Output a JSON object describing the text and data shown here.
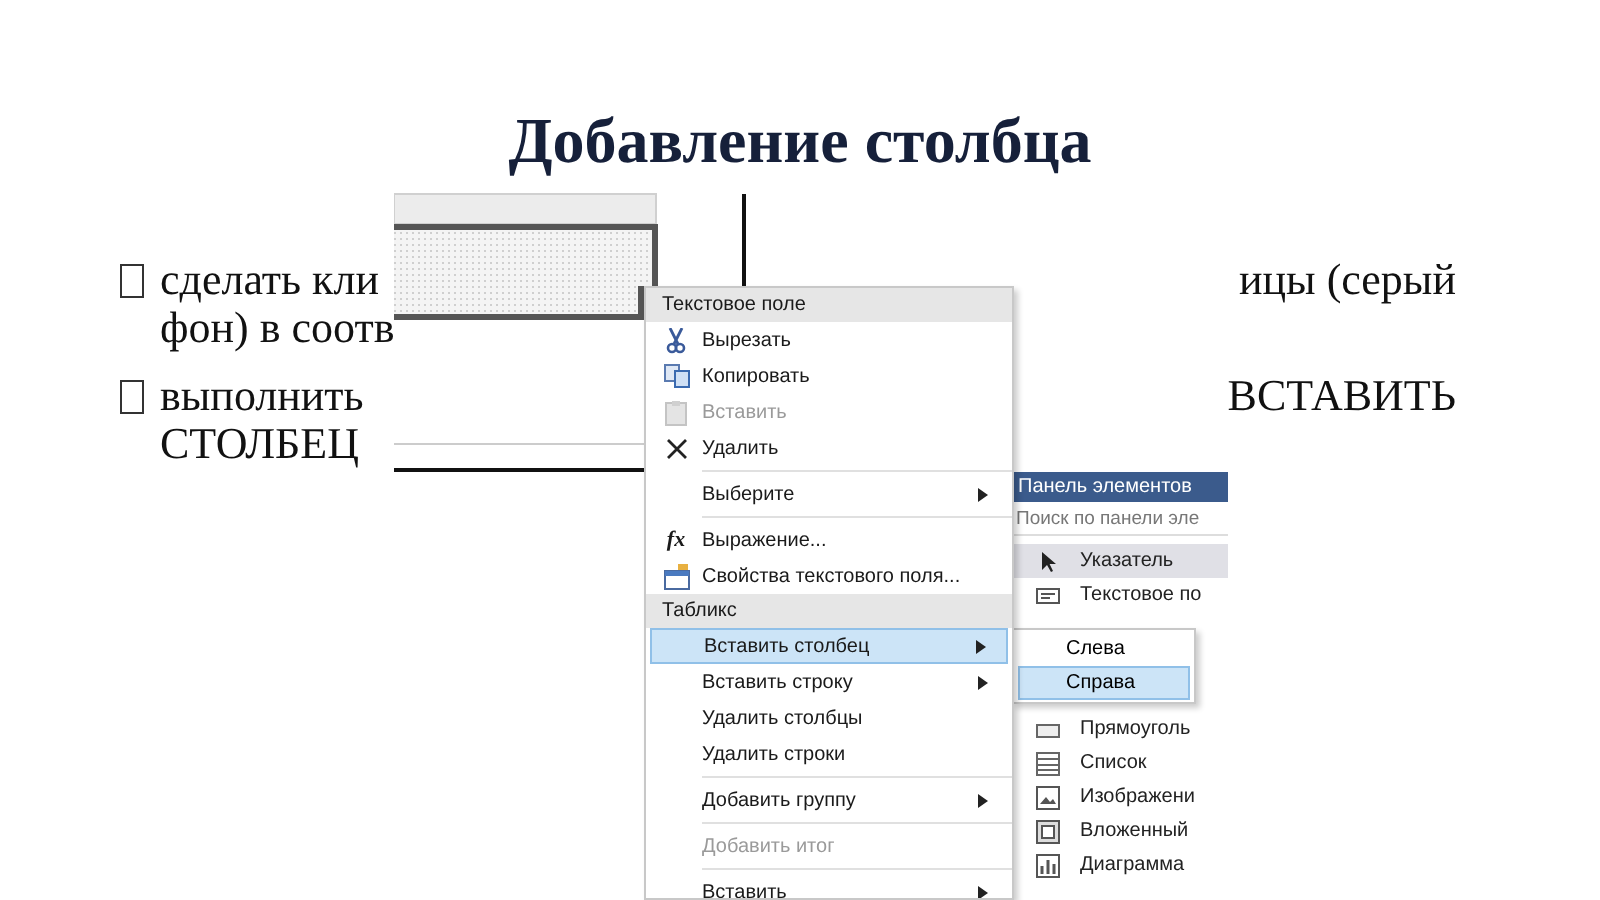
{
  "slide": {
    "title": "Добавление столбца",
    "bullets": [
      {
        "lines": [
          {
            "left": "сделать кли",
            "right": "ицы (серый"
          },
          {
            "left": "фон) в соотв"
          }
        ]
      },
      {
        "lines": [
          {
            "left": "выполнить",
            "right": "ВСТАВИТЬ"
          },
          {
            "left": "СТОЛБЕЦ"
          }
        ]
      }
    ]
  },
  "context_menu": {
    "items": [
      {
        "kind": "header",
        "label": "Текстовое поле"
      },
      {
        "kind": "item",
        "label": "Вырезать",
        "disabled": false,
        "submenu": false,
        "selected": false
      },
      {
        "kind": "item",
        "label": "Копировать",
        "disabled": false,
        "submenu": false,
        "selected": false
      },
      {
        "kind": "item",
        "label": "Вставить",
        "disabled": true,
        "submenu": false,
        "selected": false
      },
      {
        "kind": "item",
        "label": "Удалить",
        "disabled": false,
        "submenu": false,
        "selected": false
      },
      {
        "kind": "separator"
      },
      {
        "kind": "item",
        "label": "Выберите",
        "disabled": false,
        "submenu": true,
        "selected": false
      },
      {
        "kind": "separator"
      },
      {
        "kind": "item",
        "label": "Выражение...",
        "icon_text": "fx",
        "disabled": false,
        "submenu": false,
        "selected": false
      },
      {
        "kind": "item",
        "label": "Свойства текстового поля...",
        "disabled": false,
        "submenu": false,
        "selected": false
      },
      {
        "kind": "header",
        "label": "Табликс"
      },
      {
        "kind": "item",
        "label": "Вставить столбец",
        "disabled": false,
        "submenu": true,
        "selected": true
      },
      {
        "kind": "item",
        "label": "Вставить строку",
        "disabled": false,
        "submenu": true,
        "selected": false
      },
      {
        "kind": "item",
        "label": "Удалить столбцы",
        "disabled": false,
        "submenu": false,
        "selected": false
      },
      {
        "kind": "item",
        "label": "Удалить строки",
        "disabled": false,
        "submenu": false,
        "selected": false
      },
      {
        "kind": "separator"
      },
      {
        "kind": "item",
        "label": "Добавить группу",
        "disabled": false,
        "submenu": true,
        "selected": false
      },
      {
        "kind": "separator"
      },
      {
        "kind": "item",
        "label": "Добавить итог",
        "disabled": true,
        "submenu": false,
        "selected": false
      },
      {
        "kind": "separator"
      },
      {
        "kind": "item",
        "label": "Вставить",
        "disabled": false,
        "submenu": true,
        "selected": false
      }
    ]
  },
  "submenu": {
    "items": [
      {
        "label": "Слева",
        "selected": false
      },
      {
        "label": "Справа",
        "selected": true
      }
    ]
  },
  "toolbox": {
    "title": "Панель элементов",
    "search": {
      "placeholder": "Поиск по панели эле"
    },
    "items": [
      {
        "label": "Указатель",
        "selected": true
      },
      {
        "label": "Текстовое по",
        "selected": false
      },
      {
        "label": "Прямоуголь",
        "selected": false
      },
      {
        "label": "Список",
        "selected": false
      },
      {
        "label": "Изображени",
        "selected": false
      },
      {
        "label": "Вложенный",
        "selected": false
      },
      {
        "label": "Диаграмма",
        "selected": false
      }
    ]
  }
}
